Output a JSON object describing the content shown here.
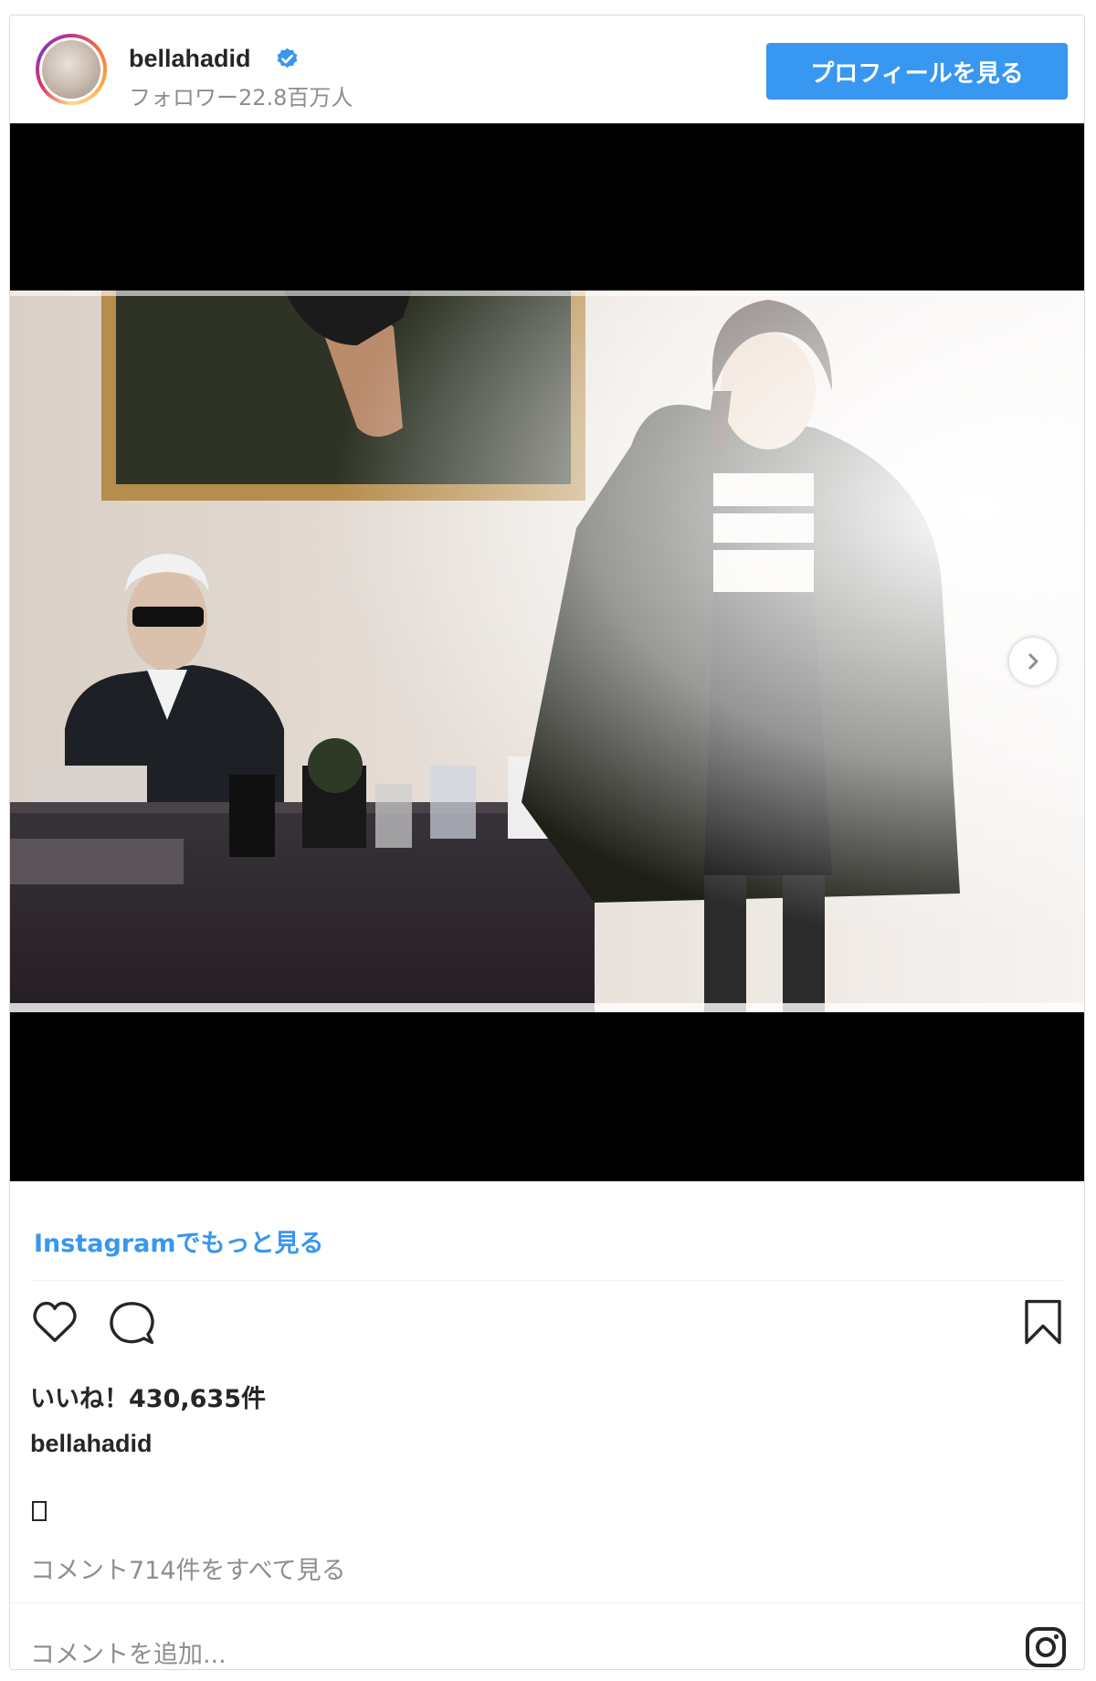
{
  "header": {
    "username": "bellahadid",
    "followers": "フォロワー22.8百万人",
    "profile_button": "プロフィールを見る"
  },
  "media": {
    "next_icon": "chevron-right-icon"
  },
  "footer": {
    "more_link": "Instagramでもっと見る",
    "likes": "いいね！430,635件",
    "caption_user": "bellahadid",
    "view_comments": "コメント714件をすべて見る",
    "add_comment_placeholder": "コメントを追加...",
    "icons": [
      "heart-icon",
      "comment-icon",
      "bookmark-icon",
      "instagram-logo-icon"
    ]
  },
  "colors": {
    "accent": "#3897f0",
    "verified": "#3897f0",
    "text_primary": "#262626",
    "text_secondary": "#8e8e8e"
  }
}
